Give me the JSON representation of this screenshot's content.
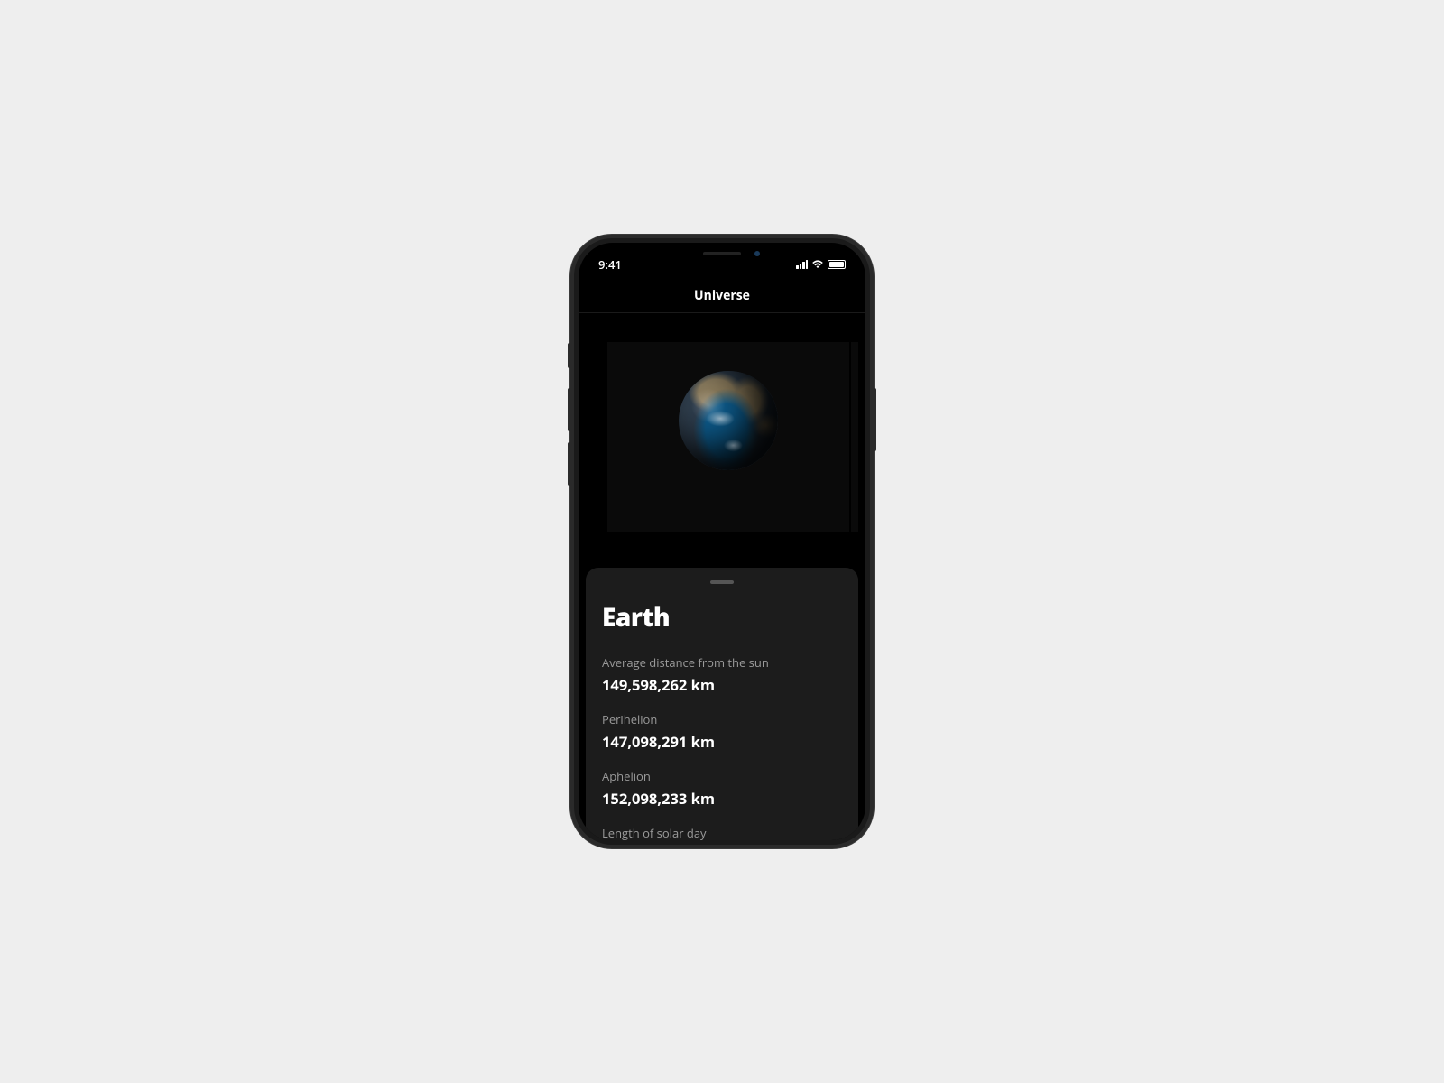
{
  "status_bar": {
    "time": "9:41"
  },
  "header": {
    "title": "Universe"
  },
  "planet": {
    "name": "Earth",
    "stats": [
      {
        "label": "Average distance from the sun",
        "value": "149,598,262 km"
      },
      {
        "label": "Perihelion",
        "value": "147,098,291 km"
      },
      {
        "label": "Aphelion",
        "value": "152,098,233 km"
      },
      {
        "label": "Length of solar day",
        "value": ""
      }
    ]
  }
}
